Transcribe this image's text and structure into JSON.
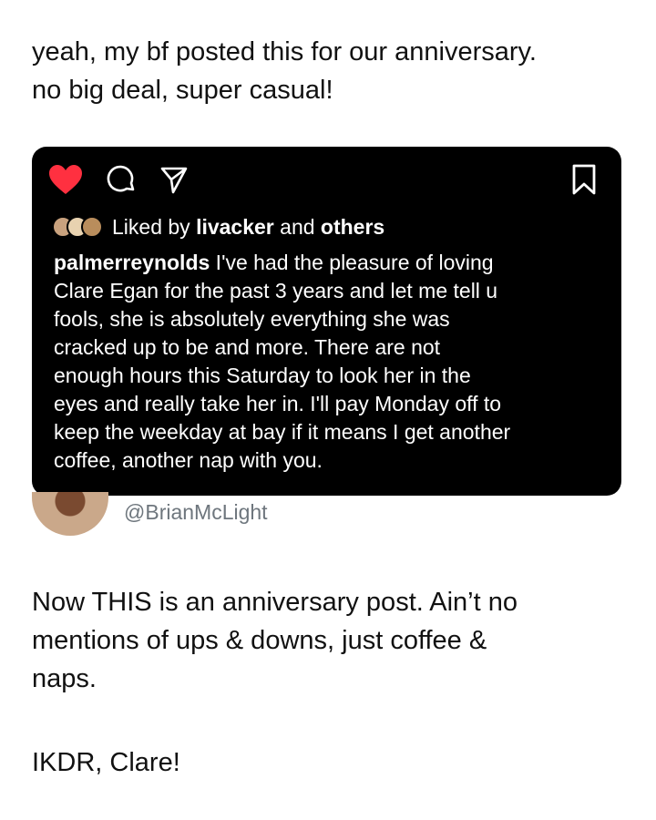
{
  "intro": {
    "lines": [
      "yeah, my bf posted this for our anniversary.",
      "no big deal, super casual!"
    ]
  },
  "instagram_post": {
    "icons": [
      "heart-icon",
      "comment-icon",
      "share-icon",
      "bookmark-icon"
    ],
    "colors": {
      "heart": "#ff3040",
      "background": "#000000"
    },
    "liked_by": {
      "prefix": "Liked by ",
      "user": "livacker",
      "middle": " and ",
      "others": "others"
    },
    "caption": {
      "username": "palmerreynolds",
      "lines": [
        " I've had the pleasure of loving",
        "Clare Egan for the past 3 years and let me tell u",
        "fools, she is absolutely everything she was",
        "cracked up to be and more. There are not",
        "enough hours this Saturday to look her in the",
        "eyes and really take her in. I'll pay Monday off to",
        "keep the weekday at bay if it means I get another",
        "coffee, another nap with you."
      ]
    }
  },
  "tweet": {
    "handle": "@BrianMcLight",
    "body_lines": [
      "Now THIS is an anniversary post. Ain’t no",
      "mentions of ups & downs, just coffee &",
      "naps."
    ],
    "signoff": "IKDR, Clare!"
  }
}
